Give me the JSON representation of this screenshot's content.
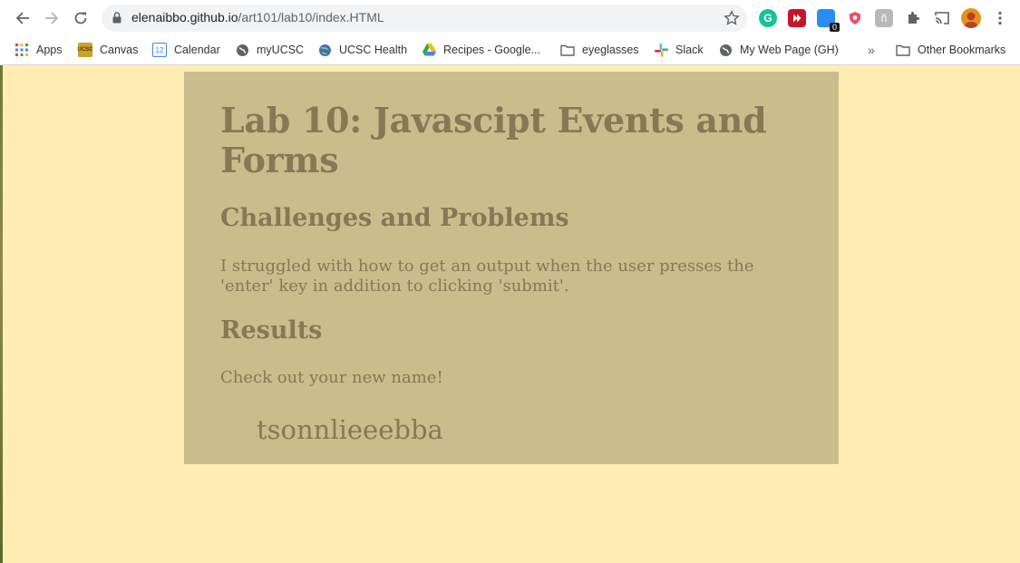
{
  "browser": {
    "url_host": "elenaibbo.github.io",
    "url_path": "/art101/lab10/index.HTML",
    "extension_badge": "0"
  },
  "bookmarks": {
    "items": [
      {
        "label": "Apps"
      },
      {
        "label": "Canvas"
      },
      {
        "label": "Calendar",
        "icon_text": "12"
      },
      {
        "label": "myUCSC"
      },
      {
        "label": "UCSC Health"
      },
      {
        "label": "Recipes - Google..."
      },
      {
        "label": "eyeglasses"
      },
      {
        "label": "Slack"
      },
      {
        "label": "My Web Page (GH)"
      }
    ],
    "overflow": "»",
    "other": "Other Bookmarks",
    "canvas_icon_text": "UCSC"
  },
  "page": {
    "title": "Lab 10: Javascipt Events and Forms",
    "challenges_heading": "Challenges and Problems",
    "challenges_text": "I struggled with how to get an output when the user presses the 'enter' key in addition to clicking 'submit'.",
    "results_heading": "Results",
    "results_text": "Check out your new name!",
    "output_name": "tsonnlieeebba"
  },
  "colors": {
    "page_bg": "#ffedb3",
    "card_bg": "#c9bd8c",
    "text": "#877955"
  }
}
